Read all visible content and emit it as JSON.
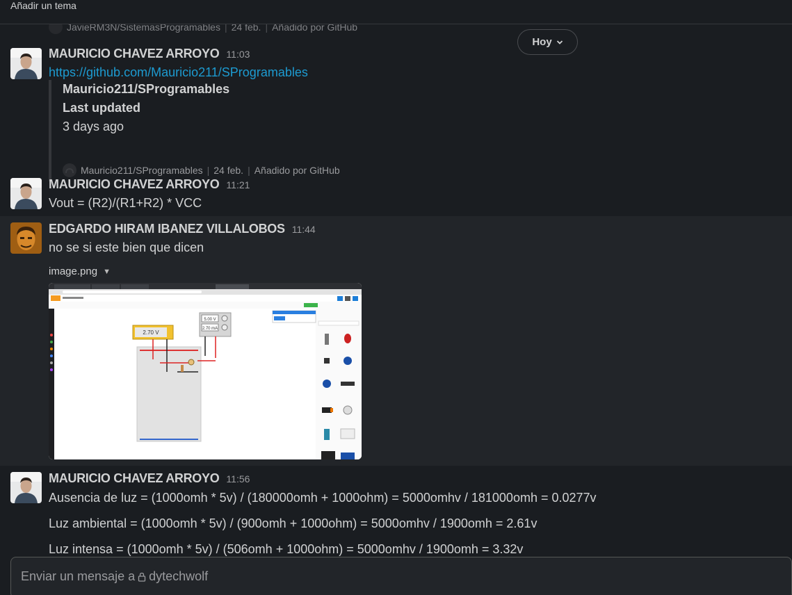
{
  "channel": {
    "topic_label": "Añadir un tema"
  },
  "previous_attachment": {
    "repo": "JavieRM3N/SistemasProgramables",
    "date": "24 feb.",
    "source": "Añadido por GitHub"
  },
  "day_divider": {
    "label": "Hoy"
  },
  "messages": [
    {
      "author": "MAURICIO CHAVEZ ARROYO",
      "time": "11:03",
      "link": "https://github.com/Mauricio211/SProgramables",
      "unfurl": {
        "title": "Mauricio211/SProgramables",
        "field_label": "Last updated",
        "field_value": "3 days ago",
        "repo": "Mauricio211/SProgramables",
        "date": "24 feb.",
        "source": "Añadido por GitHub"
      }
    },
    {
      "author": "MAURICIO CHAVEZ ARROYO",
      "time": "11:21",
      "text": "Vout = (R2)/(R1+R2) * VCC"
    },
    {
      "author": "EDGARDO HIRAM IBANEZ VILLALOBOS",
      "time": "11:44",
      "text": "no se si este bien que dicen",
      "file": {
        "name": "image.png"
      },
      "image": {
        "voltmeter": "2.70 V",
        "supply_voltage": "5.00 V",
        "supply_current": "2.70 mA"
      }
    },
    {
      "author": "MAURICIO CHAVEZ ARROYO",
      "time": "11:56",
      "lines": [
        "Ausencia de luz = (1000omh * 5v) / (180000omh + 1000ohm) = 5000omhv / 181000omh = 0.0277v",
        "Luz ambiental = (1000omh * 5v) / (900omh + 1000ohm) = 5000omhv / 1900omh = 2.61v",
        "Luz intensa = (1000omh * 5v) / (506omh + 1000ohm) = 5000omhv / 1900omh = 3.32v"
      ]
    }
  ],
  "composer": {
    "placeholder": "Enviar un mensaje a",
    "recipient": "dytechwolf"
  }
}
